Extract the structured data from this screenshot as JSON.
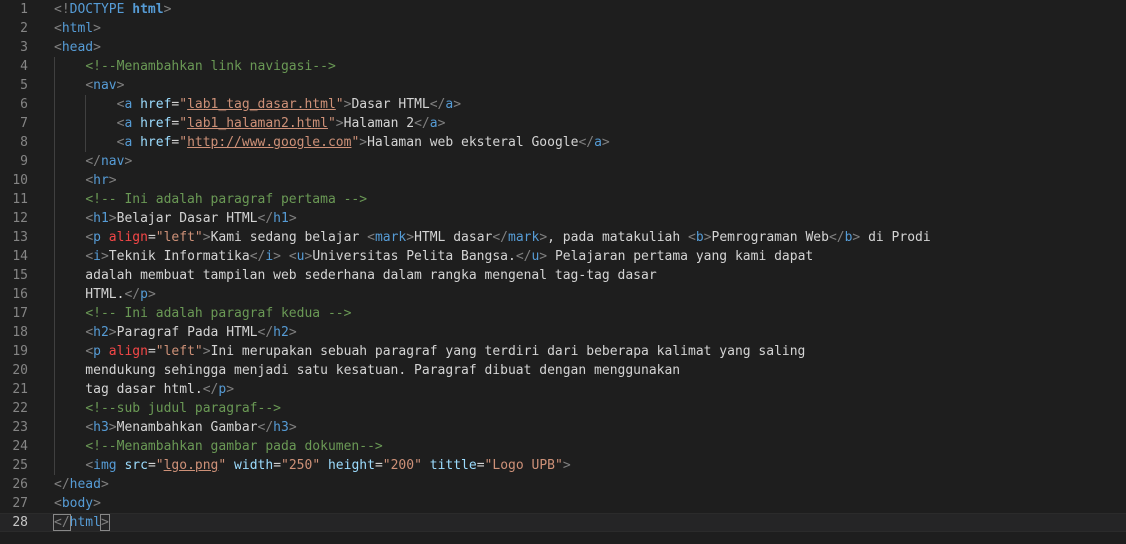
{
  "editor": {
    "language": "html",
    "current_line": 28,
    "lines": [
      [
        {
          "t": "<!",
          "c": "punc"
        },
        {
          "t": "DOCTYPE",
          "c": "tag"
        },
        {
          "t": " html",
          "c": "kw"
        },
        {
          "t": ">",
          "c": "punc"
        }
      ],
      [
        {
          "t": "<",
          "c": "punc"
        },
        {
          "t": "html",
          "c": "tag"
        },
        {
          "t": ">",
          "c": "punc"
        }
      ],
      [
        {
          "t": "<",
          "c": "punc"
        },
        {
          "t": "head",
          "c": "tag"
        },
        {
          "t": ">",
          "c": "punc"
        }
      ],
      [
        {
          "t": "    ",
          "c": "txt"
        },
        {
          "t": "<!--Menambahkan link navigasi-->",
          "c": "cmt"
        }
      ],
      [
        {
          "t": "    ",
          "c": "txt"
        },
        {
          "t": "<",
          "c": "punc"
        },
        {
          "t": "nav",
          "c": "tag"
        },
        {
          "t": ">",
          "c": "punc"
        }
      ],
      [
        {
          "t": "        ",
          "c": "txt"
        },
        {
          "t": "<",
          "c": "punc"
        },
        {
          "t": "a",
          "c": "tag"
        },
        {
          "t": " href",
          "c": "attr"
        },
        {
          "t": "=",
          "c": "txt"
        },
        {
          "t": "\"",
          "c": "str"
        },
        {
          "t": "lab1_tag_dasar.html",
          "c": "link"
        },
        {
          "t": "\"",
          "c": "str"
        },
        {
          "t": ">",
          "c": "punc"
        },
        {
          "t": "Dasar HTML",
          "c": "txt"
        },
        {
          "t": "</",
          "c": "punc"
        },
        {
          "t": "a",
          "c": "tag"
        },
        {
          "t": ">",
          "c": "punc"
        }
      ],
      [
        {
          "t": "        ",
          "c": "txt"
        },
        {
          "t": "<",
          "c": "punc"
        },
        {
          "t": "a",
          "c": "tag"
        },
        {
          "t": " href",
          "c": "attr"
        },
        {
          "t": "=",
          "c": "txt"
        },
        {
          "t": "\"",
          "c": "str"
        },
        {
          "t": "lab1_halaman2.html",
          "c": "link"
        },
        {
          "t": "\"",
          "c": "str"
        },
        {
          "t": ">",
          "c": "punc"
        },
        {
          "t": "Halaman 2",
          "c": "txt"
        },
        {
          "t": "</",
          "c": "punc"
        },
        {
          "t": "a",
          "c": "tag"
        },
        {
          "t": ">",
          "c": "punc"
        }
      ],
      [
        {
          "t": "        ",
          "c": "txt"
        },
        {
          "t": "<",
          "c": "punc"
        },
        {
          "t": "a",
          "c": "tag"
        },
        {
          "t": " href",
          "c": "attr"
        },
        {
          "t": "=",
          "c": "txt"
        },
        {
          "t": "\"",
          "c": "str"
        },
        {
          "t": "http://www.google.com",
          "c": "link"
        },
        {
          "t": "\"",
          "c": "str"
        },
        {
          "t": ">",
          "c": "punc"
        },
        {
          "t": "Halaman web eksteral Google",
          "c": "txt"
        },
        {
          "t": "</",
          "c": "punc"
        },
        {
          "t": "a",
          "c": "tag"
        },
        {
          "t": ">",
          "c": "punc"
        }
      ],
      [
        {
          "t": "    ",
          "c": "txt"
        },
        {
          "t": "</",
          "c": "punc"
        },
        {
          "t": "nav",
          "c": "tag"
        },
        {
          "t": ">",
          "c": "punc"
        }
      ],
      [
        {
          "t": "    ",
          "c": "txt"
        },
        {
          "t": "<",
          "c": "punc"
        },
        {
          "t": "hr",
          "c": "tag"
        },
        {
          "t": ">",
          "c": "punc"
        }
      ],
      [
        {
          "t": "    ",
          "c": "txt"
        },
        {
          "t": "<!-- Ini adalah paragraf pertama -->",
          "c": "cmt"
        }
      ],
      [
        {
          "t": "    ",
          "c": "txt"
        },
        {
          "t": "<",
          "c": "punc"
        },
        {
          "t": "h1",
          "c": "tag"
        },
        {
          "t": ">",
          "c": "punc"
        },
        {
          "t": "Belajar Dasar HTML",
          "c": "txt"
        },
        {
          "t": "</",
          "c": "punc"
        },
        {
          "t": "h1",
          "c": "tag"
        },
        {
          "t": ">",
          "c": "punc"
        }
      ],
      [
        {
          "t": "    ",
          "c": "txt"
        },
        {
          "t": "<",
          "c": "punc"
        },
        {
          "t": "p",
          "c": "tag"
        },
        {
          "t": " align",
          "c": "attr-err"
        },
        {
          "t": "=",
          "c": "txt"
        },
        {
          "t": "\"left\"",
          "c": "str"
        },
        {
          "t": ">",
          "c": "punc"
        },
        {
          "t": "Kami sedang belajar ",
          "c": "txt"
        },
        {
          "t": "<",
          "c": "punc"
        },
        {
          "t": "mark",
          "c": "tag"
        },
        {
          "t": ">",
          "c": "punc"
        },
        {
          "t": "HTML dasar",
          "c": "txt"
        },
        {
          "t": "</",
          "c": "punc"
        },
        {
          "t": "mark",
          "c": "tag"
        },
        {
          "t": ">",
          "c": "punc"
        },
        {
          "t": ", pada matakuliah ",
          "c": "txt"
        },
        {
          "t": "<",
          "c": "punc"
        },
        {
          "t": "b",
          "c": "tag"
        },
        {
          "t": ">",
          "c": "punc"
        },
        {
          "t": "Pemrograman Web",
          "c": "txt"
        },
        {
          "t": "</",
          "c": "punc"
        },
        {
          "t": "b",
          "c": "tag"
        },
        {
          "t": ">",
          "c": "punc"
        },
        {
          "t": " di Prodi",
          "c": "txt"
        }
      ],
      [
        {
          "t": "    ",
          "c": "txt"
        },
        {
          "t": "<",
          "c": "punc"
        },
        {
          "t": "i",
          "c": "tag"
        },
        {
          "t": ">",
          "c": "punc"
        },
        {
          "t": "Teknik Informatika",
          "c": "txt"
        },
        {
          "t": "</",
          "c": "punc"
        },
        {
          "t": "i",
          "c": "tag"
        },
        {
          "t": ">",
          "c": "punc"
        },
        {
          "t": " ",
          "c": "txt"
        },
        {
          "t": "<",
          "c": "punc"
        },
        {
          "t": "u",
          "c": "tag"
        },
        {
          "t": ">",
          "c": "punc"
        },
        {
          "t": "Universitas Pelita Bangsa.",
          "c": "txt"
        },
        {
          "t": "</",
          "c": "punc"
        },
        {
          "t": "u",
          "c": "tag"
        },
        {
          "t": ">",
          "c": "punc"
        },
        {
          "t": " Pelajaran pertama yang kami dapat",
          "c": "txt"
        }
      ],
      [
        {
          "t": "    adalah membuat tampilan web sederhana dalam rangka mengenal tag-tag dasar",
          "c": "txt"
        }
      ],
      [
        {
          "t": "    HTML.",
          "c": "txt"
        },
        {
          "t": "</",
          "c": "punc"
        },
        {
          "t": "p",
          "c": "tag"
        },
        {
          "t": ">",
          "c": "punc"
        }
      ],
      [
        {
          "t": "    ",
          "c": "txt"
        },
        {
          "t": "<!-- Ini adalah paragraf kedua -->",
          "c": "cmt"
        }
      ],
      [
        {
          "t": "    ",
          "c": "txt"
        },
        {
          "t": "<",
          "c": "punc"
        },
        {
          "t": "h2",
          "c": "tag"
        },
        {
          "t": ">",
          "c": "punc"
        },
        {
          "t": "Paragraf Pada HTML",
          "c": "txt"
        },
        {
          "t": "</",
          "c": "punc"
        },
        {
          "t": "h2",
          "c": "tag"
        },
        {
          "t": ">",
          "c": "punc"
        }
      ],
      [
        {
          "t": "    ",
          "c": "txt"
        },
        {
          "t": "<",
          "c": "punc"
        },
        {
          "t": "p",
          "c": "tag"
        },
        {
          "t": " align",
          "c": "attr-err"
        },
        {
          "t": "=",
          "c": "txt"
        },
        {
          "t": "\"left\"",
          "c": "str"
        },
        {
          "t": ">",
          "c": "punc"
        },
        {
          "t": "Ini merupakan sebuah paragraf yang terdiri dari beberapa kalimat yang saling",
          "c": "txt"
        }
      ],
      [
        {
          "t": "    mendukung sehingga menjadi satu kesatuan. Paragraf dibuat dengan menggunakan",
          "c": "txt"
        }
      ],
      [
        {
          "t": "    tag dasar html.",
          "c": "txt"
        },
        {
          "t": "</",
          "c": "punc"
        },
        {
          "t": "p",
          "c": "tag"
        },
        {
          "t": ">",
          "c": "punc"
        }
      ],
      [
        {
          "t": "    ",
          "c": "txt"
        },
        {
          "t": "<!--sub judul paragraf-->",
          "c": "cmt"
        }
      ],
      [
        {
          "t": "    ",
          "c": "txt"
        },
        {
          "t": "<",
          "c": "punc"
        },
        {
          "t": "h3",
          "c": "tag"
        },
        {
          "t": ">",
          "c": "punc"
        },
        {
          "t": "Menambahkan Gambar",
          "c": "txt"
        },
        {
          "t": "</",
          "c": "punc"
        },
        {
          "t": "h3",
          "c": "tag"
        },
        {
          "t": ">",
          "c": "punc"
        }
      ],
      [
        {
          "t": "    ",
          "c": "txt"
        },
        {
          "t": "<!--Menambahkan gambar pada dokumen-->",
          "c": "cmt"
        }
      ],
      [
        {
          "t": "    ",
          "c": "txt"
        },
        {
          "t": "<",
          "c": "punc"
        },
        {
          "t": "img",
          "c": "tag"
        },
        {
          "t": " src",
          "c": "attr"
        },
        {
          "t": "=",
          "c": "txt"
        },
        {
          "t": "\"",
          "c": "str"
        },
        {
          "t": "lgo.png",
          "c": "link"
        },
        {
          "t": "\"",
          "c": "str"
        },
        {
          "t": " width",
          "c": "attr"
        },
        {
          "t": "=",
          "c": "txt"
        },
        {
          "t": "\"250\"",
          "c": "str"
        },
        {
          "t": " height",
          "c": "attr"
        },
        {
          "t": "=",
          "c": "txt"
        },
        {
          "t": "\"200\"",
          "c": "str"
        },
        {
          "t": " tittle",
          "c": "attr"
        },
        {
          "t": "=",
          "c": "txt"
        },
        {
          "t": "\"Logo UPB\"",
          "c": "str"
        },
        {
          "t": ">",
          "c": "punc"
        }
      ],
      [
        {
          "t": "</",
          "c": "punc"
        },
        {
          "t": "head",
          "c": "tag"
        },
        {
          "t": ">",
          "c": "punc"
        }
      ],
      [
        {
          "t": "<",
          "c": "punc"
        },
        {
          "t": "body",
          "c": "tag"
        },
        {
          "t": ">",
          "c": "punc"
        }
      ],
      [
        {
          "t": "</",
          "c": "punc-match"
        },
        {
          "t": "html",
          "c": "tag"
        },
        {
          "t": ">",
          "c": "punc-match"
        }
      ]
    ]
  }
}
